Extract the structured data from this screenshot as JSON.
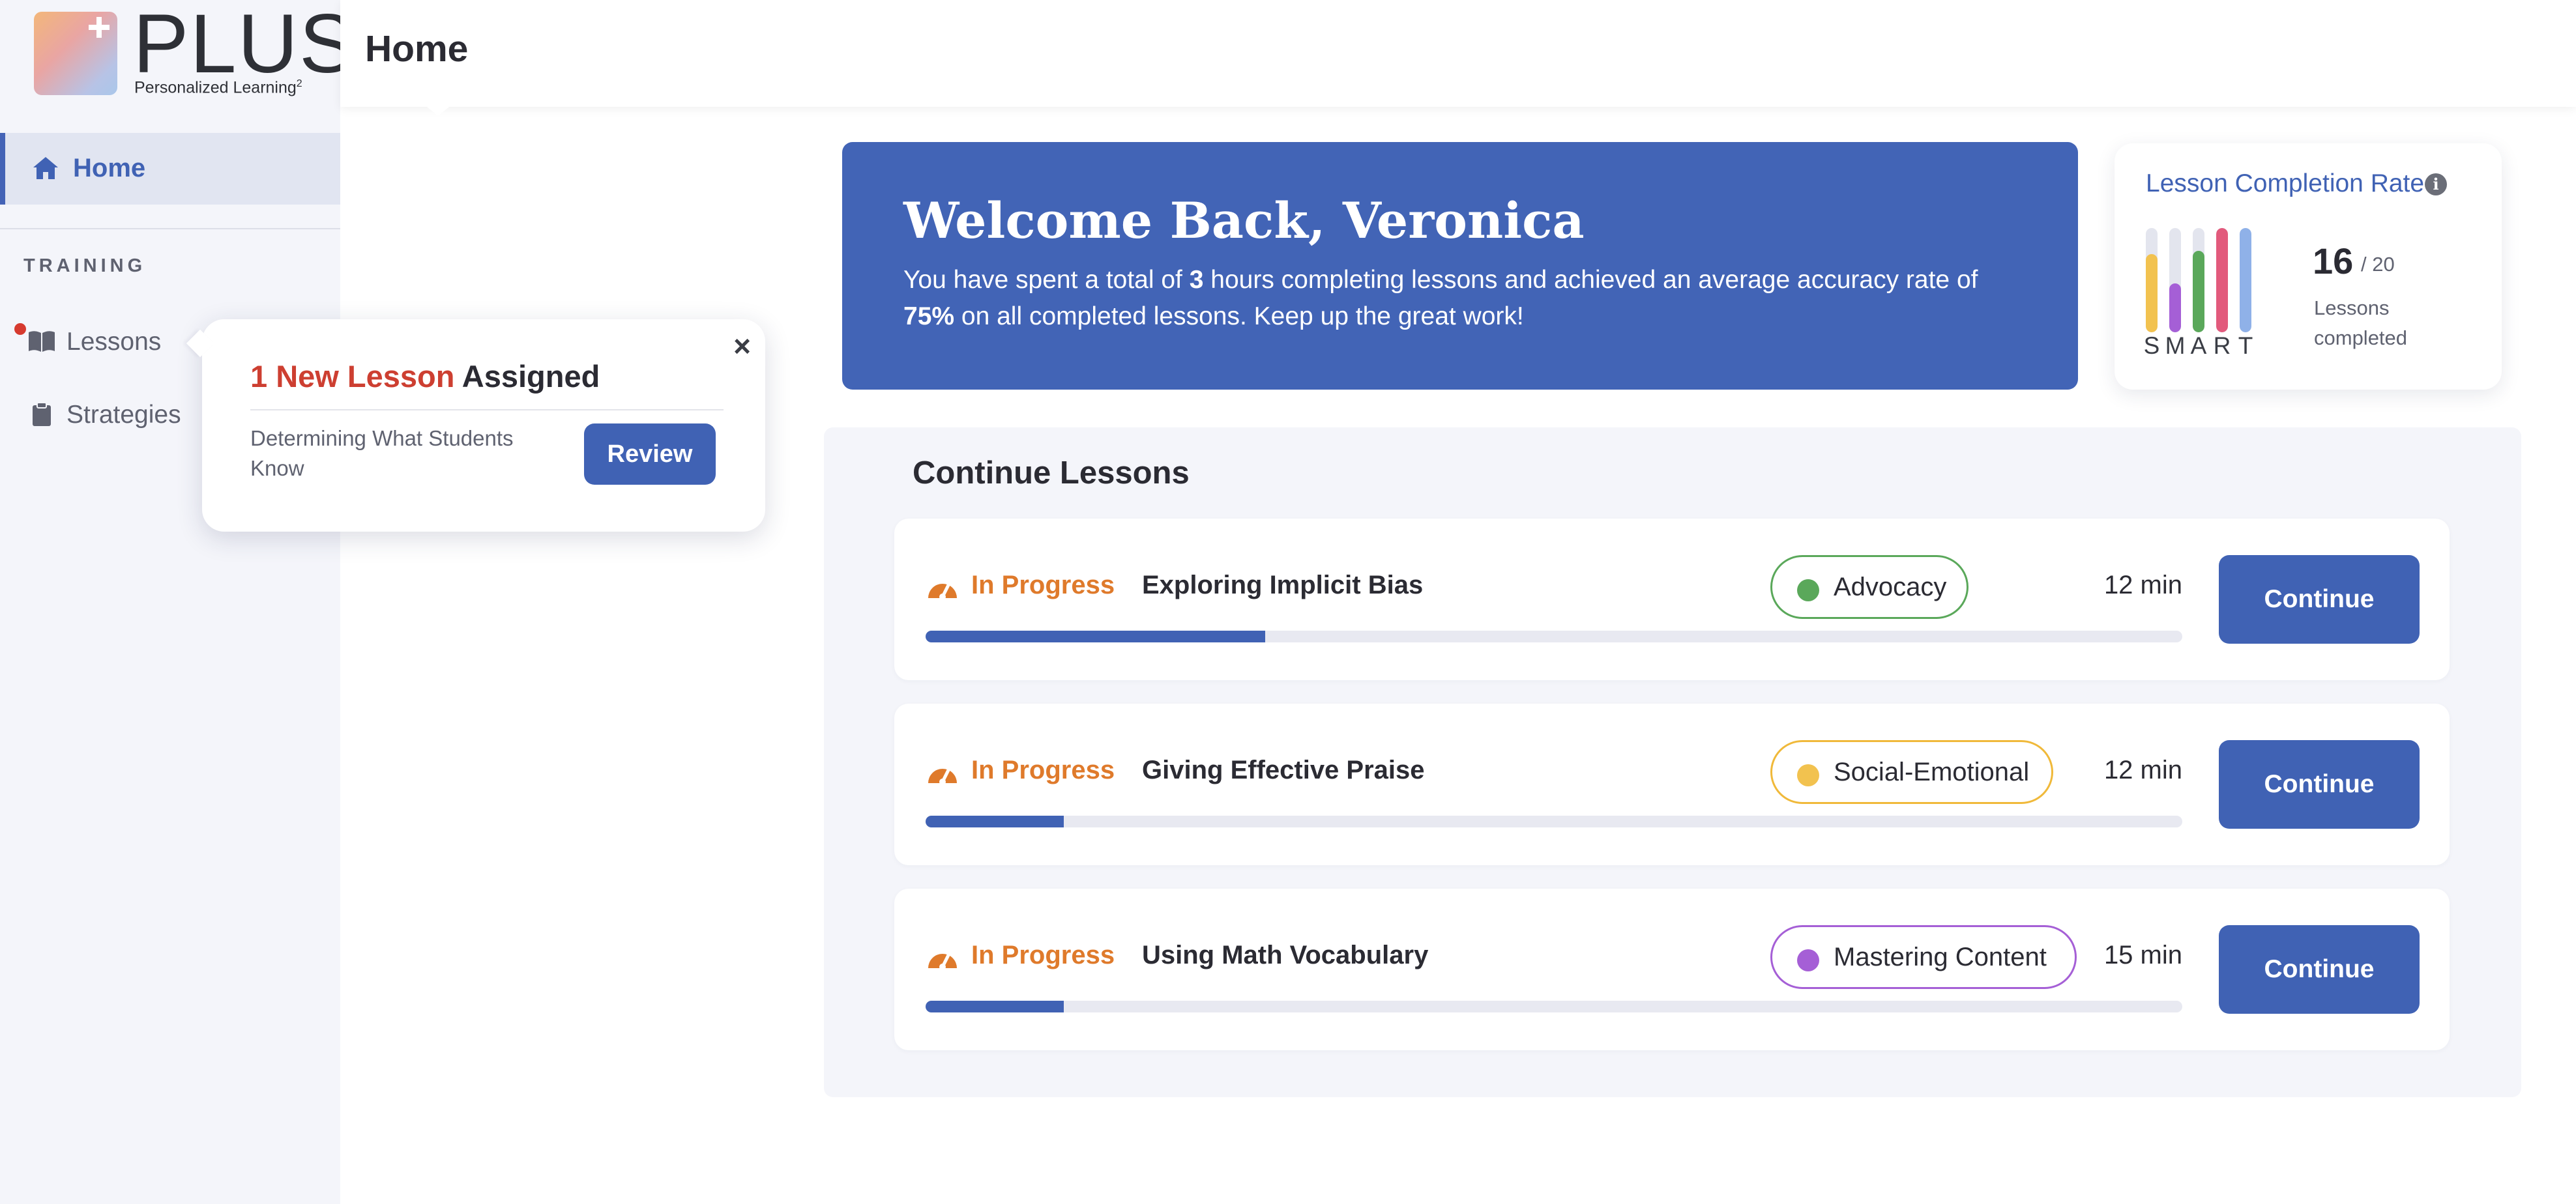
{
  "app": {
    "logo_word": "PLUS",
    "logo_tagline": "Personalized Learning",
    "logo_tagline_sup": "2"
  },
  "header": {
    "title": "Home"
  },
  "sidebar": {
    "home_label": "Home",
    "section_label": "TRAINING",
    "items": [
      {
        "label": "Lessons",
        "icon": "book-icon",
        "has_notification": true
      },
      {
        "label": "Strategies",
        "icon": "clipboard-icon",
        "has_notification": false
      }
    ]
  },
  "popup": {
    "title_highlight": "1 New Lesson",
    "title_rest": " Assigned",
    "lesson_name": "Determining What Students Know",
    "button_label": "Review",
    "close_label": "×"
  },
  "welcome": {
    "title": "Welcome Back, Veronica",
    "text_1": "You have spent a total of ",
    "hours": "3",
    "text_2": " hours completing lessons and achieved an average accuracy rate of ",
    "accuracy": "75%",
    "text_3": " on all completed lessons. Keep up the great work!"
  },
  "completion": {
    "title": "Lesson Completion Rate",
    "info_icon": "i",
    "completed": "16",
    "total": "/ 20",
    "label": "Lessons completed",
    "bars": [
      {
        "letter": "S",
        "color": "#f2c24f",
        "level": 0.75
      },
      {
        "letter": "M",
        "color": "#a55fd6",
        "level": 0.47
      },
      {
        "letter": "A",
        "color": "#5aa85a",
        "level": 0.78
      },
      {
        "letter": "R",
        "color": "#e25a7c",
        "level": 1.0
      },
      {
        "letter": "T",
        "color": "#8fb1e8",
        "level": 1.0
      }
    ]
  },
  "continue": {
    "title": "Continue Lessons",
    "lessons": [
      {
        "status": "In Progress",
        "name": "Exploring Implicit Bias",
        "tag": "Advocacy",
        "tag_color": "#5aa85a",
        "tag_border": "#5aa85a",
        "duration": "12 min",
        "progress": 0.27,
        "button": "Continue"
      },
      {
        "status": "In Progress",
        "name": "Giving Effective Praise",
        "tag": "Social-Emotional",
        "tag_color": "#f2c24f",
        "tag_border": "#f0b93a",
        "duration": "12 min",
        "progress": 0.11,
        "button": "Continue"
      },
      {
        "status": "In Progress",
        "name": "Using Math Vocabulary",
        "tag": "Mastering Content",
        "tag_color": "#a55fd6",
        "tag_border": "#a55fd6",
        "duration": "15 min",
        "progress": 0.11,
        "button": "Continue"
      }
    ]
  }
}
